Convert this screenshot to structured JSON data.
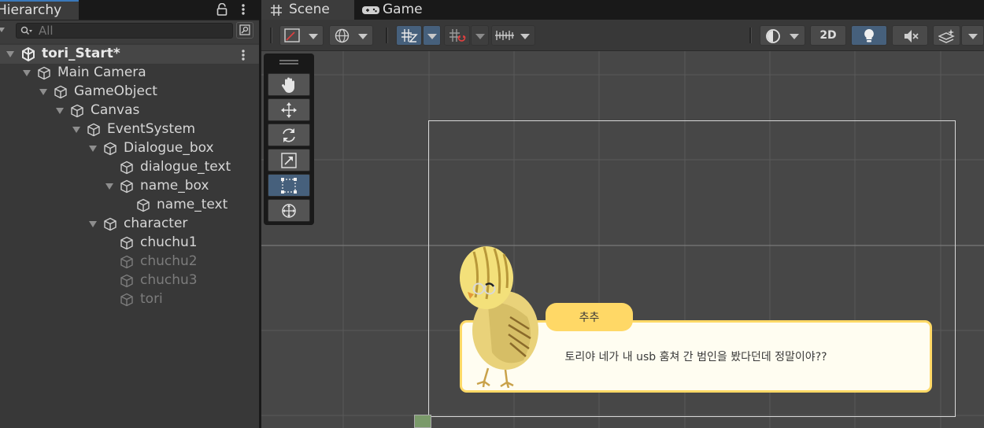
{
  "hierarchy": {
    "tab_label": "Hierarchy",
    "search": {
      "placeholder": "All",
      "value": ""
    },
    "scene": {
      "name": "tori_Start*"
    },
    "items": [
      {
        "label": "Main Camera",
        "depth": 1,
        "expanded": true,
        "dimmed": false
      },
      {
        "label": "GameObject",
        "depth": 2,
        "expanded": true,
        "dimmed": false
      },
      {
        "label": "Canvas",
        "depth": 3,
        "expanded": true,
        "dimmed": false
      },
      {
        "label": "EventSystem",
        "depth": 4,
        "expanded": true,
        "dimmed": false
      },
      {
        "label": "Dialogue_box",
        "depth": 5,
        "expanded": true,
        "dimmed": false
      },
      {
        "label": "dialogue_text",
        "depth": 6,
        "expanded": false,
        "dimmed": false
      },
      {
        "label": "name_box",
        "depth": 6,
        "expanded": true,
        "dimmed": false
      },
      {
        "label": "name_text",
        "depth": 7,
        "expanded": false,
        "dimmed": false
      },
      {
        "label": "character",
        "depth": 5,
        "expanded": true,
        "dimmed": false
      },
      {
        "label": "chuchu1",
        "depth": 6,
        "expanded": false,
        "dimmed": false
      },
      {
        "label": "chuchu2",
        "depth": 6,
        "expanded": false,
        "dimmed": true
      },
      {
        "label": "chuchu3",
        "depth": 6,
        "expanded": false,
        "dimmed": true
      },
      {
        "label": "tori",
        "depth": 6,
        "expanded": false,
        "dimmed": true
      }
    ]
  },
  "tabs": [
    {
      "label": "Scene",
      "icon": "grid-icon",
      "active": true
    },
    {
      "label": "Game",
      "icon": "gamepad-icon",
      "active": false
    }
  ],
  "toolbar": {
    "mode_2d_label": "2D",
    "buttons": [
      "draw-mode-icon",
      "global-icon",
      "grid-snap-icon",
      "increment-snap-icon",
      "ruler-icon",
      "shading-icon",
      "2d-toggle",
      "lighting-icon",
      "audio-mute-icon",
      "effects-icon"
    ]
  },
  "tools": [
    {
      "name": "hand-tool",
      "active": false
    },
    {
      "name": "move-tool",
      "active": false
    },
    {
      "name": "rotate-tool",
      "active": false
    },
    {
      "name": "scale-tool",
      "active": false
    },
    {
      "name": "rect-tool",
      "active": true
    },
    {
      "name": "transform-tool",
      "active": false
    }
  ],
  "game_view": {
    "name_text": "추추",
    "dialogue_text": "토리야 네가 내 usb 훔쳐 간 범인을 봤다던데 정말이야??",
    "colors": {
      "name_box": "#ffd866",
      "dialogue_border": "#ffd966",
      "dialogue_bg": "#fffdf1"
    }
  },
  "colors": {
    "accent": "#3a79bb",
    "active_button": "#46607c",
    "panel": "#383838"
  }
}
